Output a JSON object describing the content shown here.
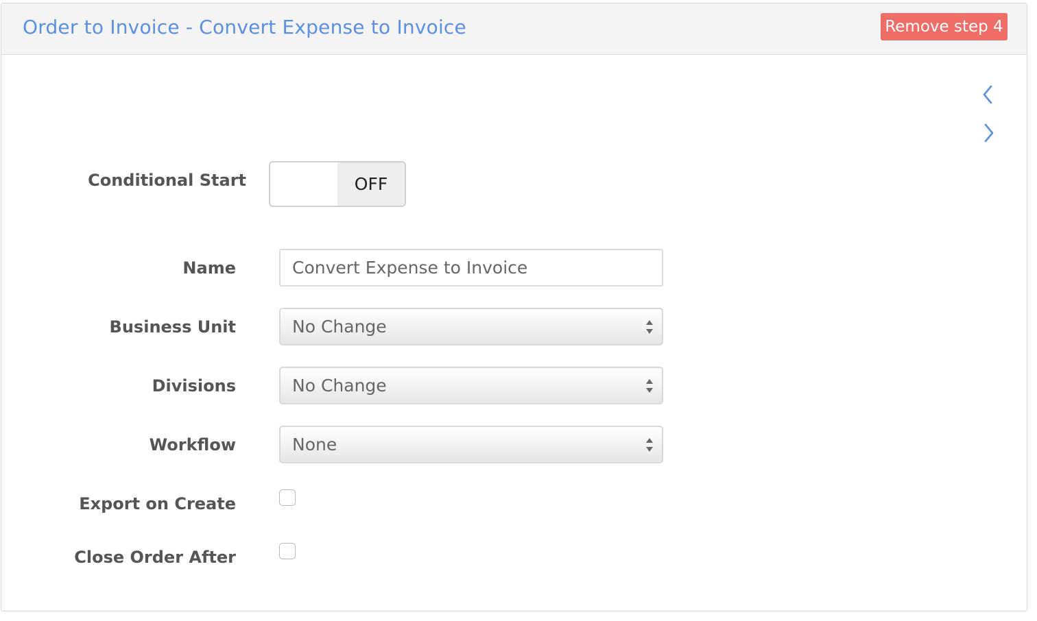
{
  "header": {
    "title": "Order to Invoice - Convert Expense to Invoice",
    "remove_step_label": "Remove step 4"
  },
  "nav": {
    "prev_icon": "chevron-left-icon",
    "next_icon": "chevron-right-icon"
  },
  "form": {
    "conditional_start": {
      "label": "Conditional Start",
      "state": "OFF"
    },
    "name": {
      "label": "Name",
      "value": "Convert Expense to Invoice"
    },
    "business_unit": {
      "label": "Business Unit",
      "value": "No Change"
    },
    "divisions": {
      "label": "Divisions",
      "value": "No Change"
    },
    "workflow": {
      "label": "Workflow",
      "value": "None"
    },
    "export_on_create": {
      "label": "Export on Create",
      "checked": false
    },
    "close_order_after": {
      "label": "Close Order After",
      "checked": false
    }
  },
  "colors": {
    "title": "#5b8fe0",
    "remove_button": "#ee6d67",
    "nav_arrows": "#5b8fe0",
    "label_text": "#555555"
  }
}
